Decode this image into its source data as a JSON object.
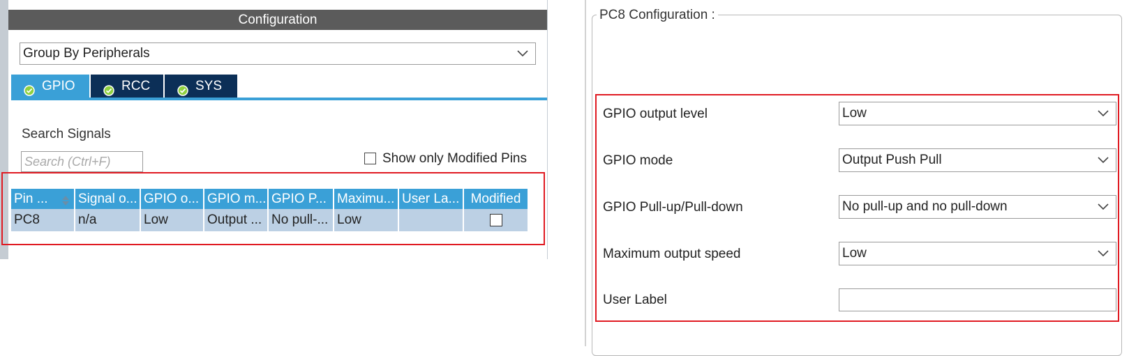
{
  "left": {
    "header_title": "Configuration",
    "group_select_value": "Group By Peripherals",
    "tabs": [
      {
        "label": "GPIO",
        "active": true
      },
      {
        "label": "RCC",
        "active": false
      },
      {
        "label": "SYS",
        "active": false
      }
    ],
    "search_title": "Search Signals",
    "search_placeholder": "Search (Ctrl+F)",
    "show_modified_label": "Show only Modified Pins",
    "show_modified_checked": false,
    "table": {
      "columns": [
        "Pin ...",
        "Signal o...",
        "GPIO o...",
        "GPIO m...",
        "GPIO P...",
        "Maximu...",
        "User La...",
        "Modified"
      ],
      "rows": [
        [
          "PC8",
          "n/a",
          "Low",
          "Output ...",
          "No pull-...",
          "Low",
          "",
          ""
        ]
      ],
      "row_modified_checked": false
    }
  },
  "right": {
    "legend": "PC8 Configuration :",
    "properties": [
      {
        "label": "GPIO output level",
        "value": "Low"
      },
      {
        "label": "GPIO mode",
        "value": "Output Push Pull"
      },
      {
        "label": "GPIO Pull-up/Pull-down",
        "value": "No pull-up and no pull-down"
      },
      {
        "label": "Maximum output speed",
        "value": "Low"
      },
      {
        "label": "User Label",
        "value": ""
      }
    ]
  },
  "colors": {
    "accent": "#3aa0d7",
    "tab_inactive": "#0c2f57",
    "header": "#5b5b5b",
    "highlight": "#e01a22",
    "row_bg": "#bcd0e4"
  },
  "icons": {
    "tab_icon": "check-circle-icon",
    "dropdown_icon": "chevron-down-icon",
    "sort_icon": "sort-arrows-icon"
  }
}
